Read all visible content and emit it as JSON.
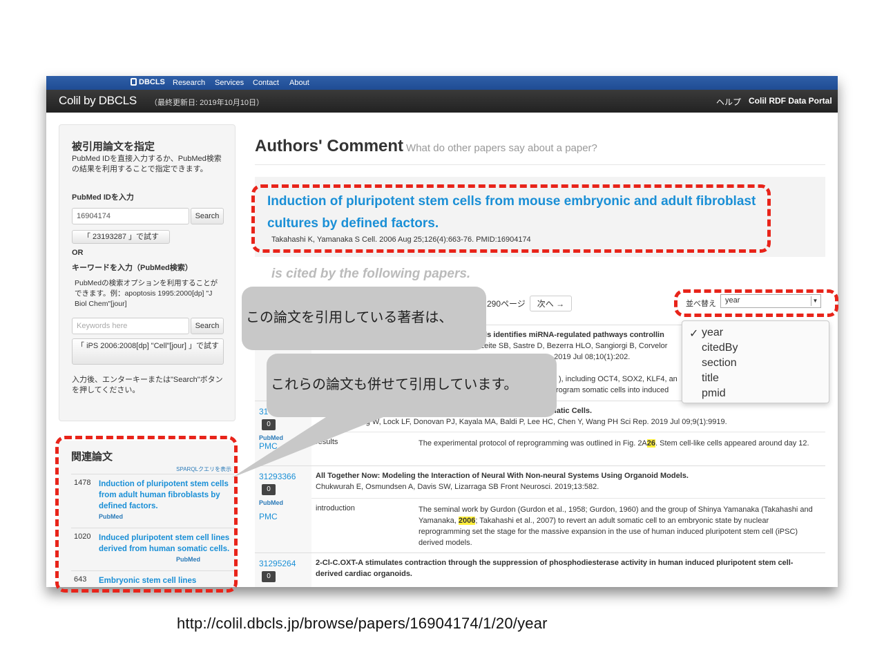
{
  "topnav": {
    "brand": "DBCLS",
    "items": [
      "Research",
      "Services",
      "Contact",
      "About"
    ]
  },
  "header": {
    "logo": "Colil by DBCLS",
    "updated": "（最終更新日: 2019年10月10日）",
    "help": "ヘルプ",
    "portal": "Colil RDF Data Portal"
  },
  "sidebar": {
    "title": "被引用論文を指定",
    "desc": "PubMed IDを直接入力するか、PubMed検索の結果を利用することで指定できます。",
    "pmid_label": "PubMed IDを入力",
    "pmid_value": "16904174",
    "search_label": "Search",
    "try_pmid": "「 23193287 」で試す",
    "or": "OR",
    "kw_label": "キーワードを入力（PubMed検索）",
    "kw_desc": "PubMedの検索オプションを利用することができます。例：apoptosis 1995:2000[dp] \"J Biol Chem\"[jour]",
    "kw_placeholder": "Keywords here",
    "search_label2": "Search",
    "try_kw": "「 iPS 2006:2008[dp] \"Cell\"[jour] 」で試す",
    "note": "入力後、エンターキーまたは\"Search\"ボタンを押してください。"
  },
  "related": {
    "title": "関連論文",
    "sparql": "SPARQLクエリを表示",
    "items": [
      {
        "count": "1478",
        "title": "Induction of pluripotent stem cells from adult human fibroblasts by defined factors.",
        "pubmed": "PubMed"
      },
      {
        "count": "1020",
        "title": "Induced pluripotent stem cell lines derived from human somatic cells.",
        "pubmed": "PubMed"
      },
      {
        "count": "643",
        "title": "Embryonic stem cell lines"
      }
    ]
  },
  "main": {
    "heading": "Authors' Comment",
    "subheading": "What do other papers say about a paper?",
    "paper_title": "Induction of pluripotent stem cells from mouse embryonic and adult fibroblast cultures by defined factors.",
    "paper_meta": "Takahashi K, Yamanaka S    Cell. 2006 Aug 25;126(4):663-76.    PMID:16904174",
    "cited_by": "is cited by the following papers.",
    "pages": "290ページ",
    "next": "次へ →",
    "sort_label": "並べ替え",
    "sort_value": "year",
    "sort_options": [
      "year",
      "citedBy",
      "section",
      "title",
      "pmid"
    ]
  },
  "rows": [
    {
      "title_frag": "lls identifies miRNA-regulated pathways controllin",
      "authors_frag": "Leite SB, Sastre D, Bezerra HLO, Sangiorgi B, Corvelor",
      "journal_frag": "r. 2019 Jul 08;10(1):202.",
      "ctx_frag1": "), including OCT4, SOX2, KLF4, an",
      "ctx_frag2": "rogram somatic cells into induced"
    },
    {
      "pmid": "31",
      "badge": "0",
      "pmc": "PMC",
      "title_frag": "natic Cells.",
      "authors": "Su CC, Deng W, Lock LF, Donovan PJ, Kayala MA, Baldi P, Lee HC, Chen Y, Wang PH     Sci Rep. 2019 Jul 09;9(1):9919.",
      "section": "results",
      "text_a": "The experimental protocol of reprogramming was outlined in Fig. 2A",
      "text_hl": "26",
      "text_b": ". Stem cell-like cells appeared around day 12."
    },
    {
      "pmid": "31293366",
      "badge": "0",
      "pmc": "PMC",
      "title": "All Together Now: Modeling the Interaction of Neural With Non-neural Systems Using Organoid Models.",
      "authors": "Chukwurah E, Osmundsen A, Davis SW, Lizarraga SB     Front Neurosci. 2019;13:582.",
      "section": "introduction",
      "text_a": "The seminal work by Gurdon (Gurdon et al., 1958; Gurdon, 1960) and the group of Shinya Yamanaka (Takahashi and Yamanaka, ",
      "text_hl": "2006",
      "text_b": "; Takahashi et al., 2007) to revert an adult somatic cell to an embryonic state by nuclear reprogramming set the stage for the massive expansion in the use of human induced pluripotent stem cell (iPSC) derived models."
    },
    {
      "pmid": "31295264",
      "badge": "0",
      "title": "2-Cl-C.OXT-A stimulates contraction through the suppression of phosphodiesterase activity in human induced pluripotent stem cell-derived cardiac organoids."
    }
  ],
  "bubbles": {
    "b1": "この論文を引用している著者は、",
    "b2": "これらの論文も併せて引用しています。"
  },
  "url": "http://colil.dbcls.jp/browse/papers/16904174/1/20/year",
  "colors": {
    "accent": "#1a8fd6",
    "annotation": "#e8241a",
    "navbar": "#1f4c93"
  }
}
